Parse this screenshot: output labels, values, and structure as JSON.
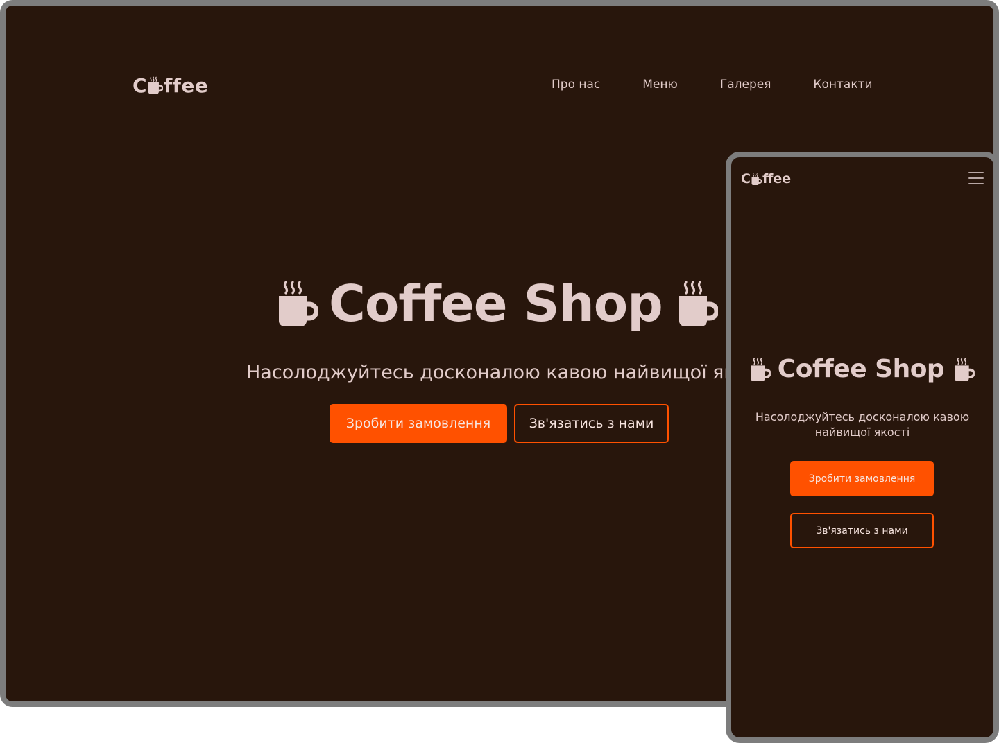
{
  "desktop": {
    "logo": {
      "before": "C",
      "after": "ffee"
    },
    "nav": [
      "Про нас",
      "Меню",
      "Галерея",
      "Контакти"
    ],
    "hero": {
      "title": "Coffee Shop",
      "subtitle": "Насолоджуйтесь досконалою кавою найвищої яко",
      "order_button": "Зробити замовлення",
      "contact_button": "Зв'язатись з нами"
    }
  },
  "mobile": {
    "logo": {
      "before": "C",
      "after": "ffee"
    },
    "menu_icon": "hamburger-icon",
    "hero": {
      "title": "Coffee Shop",
      "subtitle": "Насолоджуйтесь досконалою кавою найвищої якості",
      "order_button": "Зробити замовлення",
      "contact_button": "Зв'язатись з нами"
    }
  },
  "colors": {
    "background": "#28160c",
    "text": "#e2ccca",
    "accent": "#ff5100",
    "frame": "#7d7d7d"
  },
  "icons": {
    "cup": "coffee-cup-icon"
  }
}
